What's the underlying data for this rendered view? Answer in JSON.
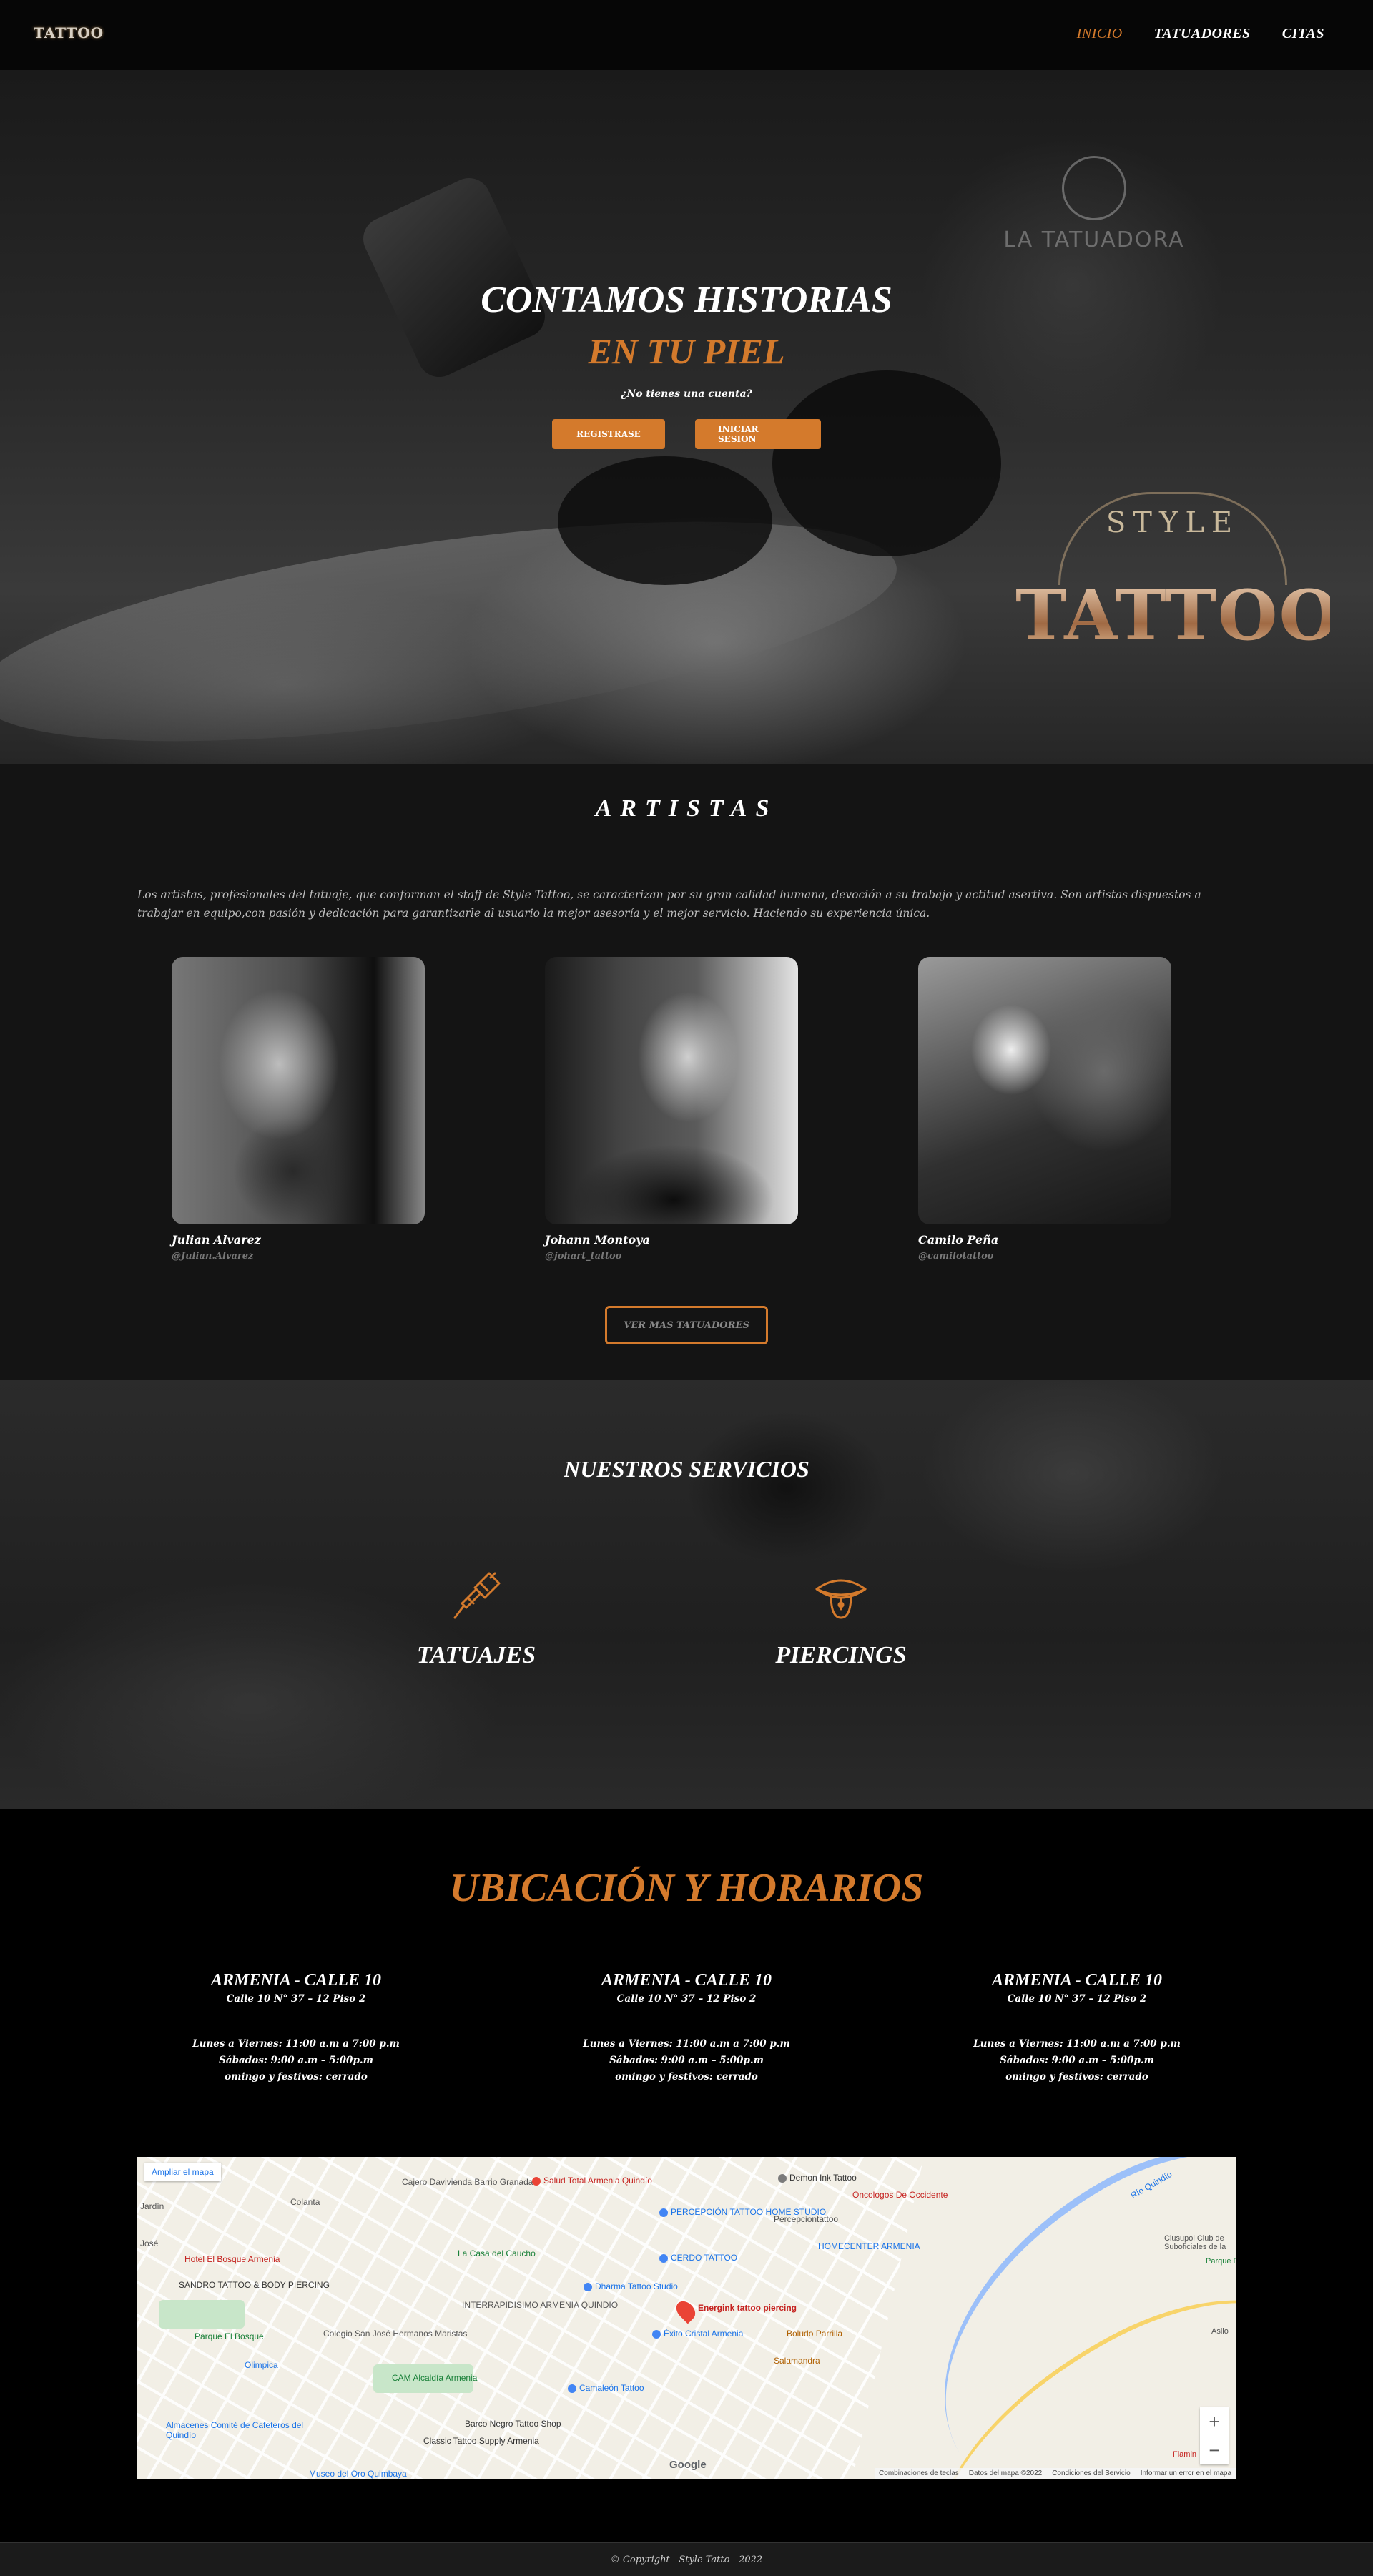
{
  "nav": {
    "logo_text": "TATTOO",
    "items": [
      {
        "label": "INICIO",
        "active": true
      },
      {
        "label": "TATUADORES",
        "active": false
      },
      {
        "label": "CITAS",
        "active": false
      }
    ]
  },
  "hero": {
    "title_line1": "CONTAMOS HISTORIAS",
    "title_line2": "EN TU PIEL",
    "question": "¿No tienes una cuenta?",
    "register_label": "REGISTRASE",
    "login_label": "INICIAR SESION",
    "brand_style": "STYLE",
    "brand_tattoo": "TATTOO",
    "sign_text": "LA TATUADORA"
  },
  "artistas": {
    "title": "ARTISTAS",
    "description": "Los artistas, profesionales del tatuaje, que conforman el staff de Style Tattoo, se caracterizan por su gran calidad humana, devoción a su trabajo y actitud asertiva. Son artistas dispuestos a trabajar en equipo,con pasión y dedicación para garantizarle al usuario la mejor asesoría y el mejor servicio. Haciendo su experiencia única.",
    "cards": [
      {
        "name": "Julian Alvarez",
        "handle": "@Julian.Alvarez"
      },
      {
        "name": "Johann Montoya",
        "handle": "@johart_tattoo"
      },
      {
        "name": "Camilo Peña",
        "handle": "@camilotattoo"
      }
    ],
    "more_label": "VER MAS TATUADORES"
  },
  "servicios": {
    "title": "NUESTROS SERVICIOS",
    "items": [
      {
        "label": "TATUAJES",
        "icon": "tattoo-machine-icon"
      },
      {
        "label": "PIERCINGS",
        "icon": "tongue-piercing-icon"
      }
    ]
  },
  "ubicacion": {
    "title": "UBICACIÓN Y HORARIOS",
    "locations": [
      {
        "city": "ARMENIA - CALLE 10",
        "address": "Calle 10 N° 37 – 12 Piso 2",
        "h1": "Lunes a Viernes: 11:00 a.m a 7:00 p.m",
        "h2": "Sábados: 9:00 a.m – 5:00p.m",
        "h3": "omingo y festivos: cerrado"
      },
      {
        "city": "ARMENIA - CALLE 10",
        "address": "Calle 10 N° 37 – 12 Piso 2",
        "h1": "Lunes a Viernes: 11:00 a.m a 7:00 p.m",
        "h2": "Sábados: 9:00 a.m – 5:00p.m",
        "h3": "omingo y festivos: cerrado"
      },
      {
        "city": "ARMENIA - CALLE 10",
        "address": "Calle 10 N° 37 – 12 Piso 2",
        "h1": "Lunes a Viernes: 11:00 a.m a 7:00 p.m",
        "h2": "Sábados: 9:00 a.m – 5:00p.m",
        "h3": "omingo y festivos: cerrado"
      }
    ]
  },
  "map": {
    "ampliar": "Ampliar el mapa",
    "marker_label": "Energink tattoo piercing",
    "places": [
      "Cajero Davivienda Barrio Granada",
      "Salud Total Armenia Quindío",
      "Demon Ink Tattoo",
      "Oncologos De Occidente",
      "Colanta",
      "PERCEPCIÓN TATTOO HOME STUDIO",
      "Percepciontattoo",
      "HOMECENTER ARMENIA",
      "Hotel El Bosque Armenia",
      "La Casa del Caucho",
      "CERDO TATTOO",
      "SANDRO TATTOO & BODY PIERCING",
      "Dharma Tattoo Studio",
      "Parque El Bosque",
      "Colegio San José Hermanos Maristas",
      "INTERRAPIDISIMO ARMENIA QUINDIO",
      "Éxito Cristal Armenia",
      "Boludo Parrilla",
      "Olimpica",
      "Salamandra",
      "CAM Alcaldía Armenia",
      "Camaleón Tattoo",
      "Almacenes Comité de Cafeteros del Quindío",
      "Barco Negro Tattoo Shop",
      "Classic Tattoo Supply Armenia",
      "Museo del Oro Quimbaya",
      "Clusupol Club de Suboficiales de la",
      "Parque Flora",
      "Río Quindío",
      "Jardín",
      "José",
      "Asilo",
      "Flamin"
    ],
    "google": "Google",
    "attribution": [
      "Combinaciones de teclas",
      "Datos del mapa ©2022",
      "Condiciones del Servicio",
      "Informar un error en el mapa"
    ]
  },
  "footer": {
    "copyright": "© Copyright - Style Tatto - 2022"
  },
  "colors": {
    "accent": "#d47a2c"
  }
}
